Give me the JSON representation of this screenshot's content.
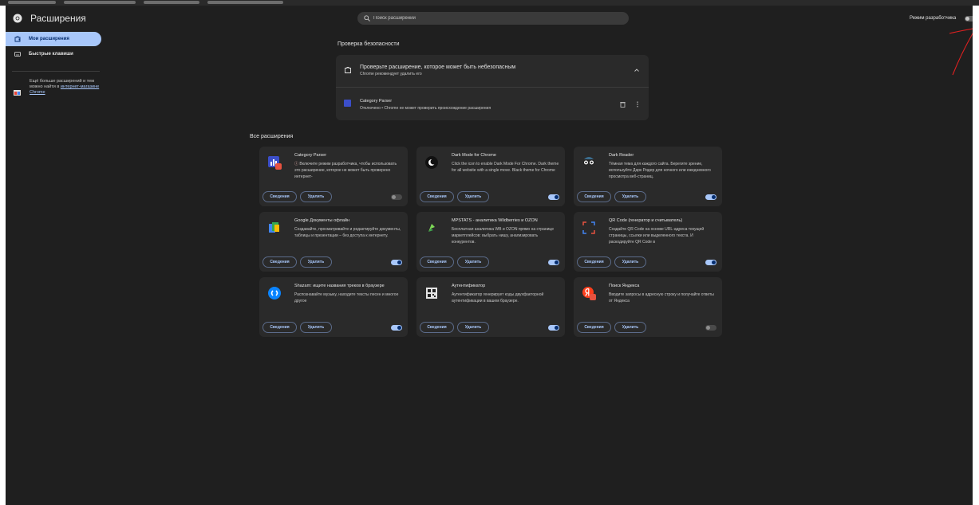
{
  "header": {
    "title": "Расширения",
    "search_placeholder": "Поиск расширений",
    "dev_mode_label": "Режим разработчика"
  },
  "sidebar": {
    "items": [
      {
        "label": "Мои расширения",
        "active": true
      },
      {
        "label": "Быстрые клавиши",
        "active": false
      }
    ],
    "promo_text": "Ещё больше расширений и тем можно найти в",
    "promo_link": "интернет-магазине Chrome"
  },
  "safety": {
    "section_title": "Проверка безопасности",
    "title": "Проверьте расширение, которое может быть небезопасным",
    "subtitle": "Chrome рекомендует удалить его",
    "ext_name": "Category Parser",
    "ext_status": "Отключено • Chrome не может проверить происхождение расширения"
  },
  "all_section_title": "Все расширения",
  "buttons": {
    "details": "Сведения",
    "remove": "Удалить"
  },
  "extensions": [
    {
      "name": "Category Parser",
      "desc": "Включите режим разработчика, чтобы использовать это расширение, которое не может быть проверено интернет-",
      "enabled": false,
      "warning": true
    },
    {
      "name": "Dark Mode for Chrome",
      "desc": "Click the icon to enable Dark Mode For Chrome. Dark theme for all website with a single move. Black theme for Chrome",
      "enabled": true
    },
    {
      "name": "Dark Reader",
      "desc": "Тёмная тема для каждого сайта. Берегите зрение, используйте Дарк Ридер для ночного или ежедневного просмотра веб-страниц.",
      "enabled": true
    },
    {
      "name": "Google Документы офлайн",
      "desc": "Создавайте, просматривайте и редактируйте документы, таблицы и презентации – без доступа к интернету.",
      "enabled": true
    },
    {
      "name": "MPSTATS - аналитика Wildberries и OZON",
      "desc": "Бесплатная аналитика WB и OZON прямо на странице маркетплейсов: выбрать нишу, анализировать конкурентов.",
      "enabled": true
    },
    {
      "name": "QR Code (генератор и считыватель)",
      "desc": "Создайте QR Code на основе URL-адреса текущей страницы, ссылки или выделенного текста. И раскодируйте QR Code в",
      "enabled": true
    },
    {
      "name": "Shazam: ищите названия треков в браузере",
      "desc": "Распознавайте музыку, находите тексты песен и многое другое",
      "enabled": true
    },
    {
      "name": "Аутентификатор",
      "desc": "Аутентификатор генерирует коды двухфакторной аутентификации в вашем браузере.",
      "enabled": true
    },
    {
      "name": "Поиск Яндекса",
      "desc": "Вводите запросы в адресную строку и получайте ответы от Яндекса",
      "enabled": false
    }
  ],
  "colors": {
    "background": "#1f1f1f",
    "card": "#2a2a2a",
    "accent": "#a8c7fa",
    "annotation": "#e02020"
  }
}
